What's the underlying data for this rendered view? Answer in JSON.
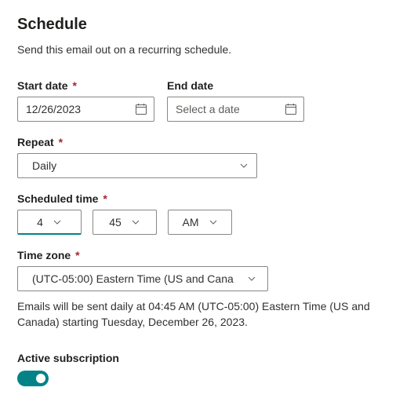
{
  "header": {
    "title": "Schedule",
    "description": "Send this email out on a recurring schedule."
  },
  "startDate": {
    "label": "Start date",
    "value": "12/26/2023",
    "required": true
  },
  "endDate": {
    "label": "End date",
    "placeholder": "Select a date",
    "required": false
  },
  "repeat": {
    "label": "Repeat",
    "value": "Daily",
    "required": true
  },
  "scheduledTime": {
    "label": "Scheduled time",
    "hour": "4",
    "minute": "45",
    "ampm": "AM",
    "required": true
  },
  "timezone": {
    "label": "Time zone",
    "value": "(UTC-05:00) Eastern Time (US and Cana",
    "required": true
  },
  "summary": "Emails will be sent daily at 04:45 AM (UTC-05:00) Eastern Time (US and Canada) starting Tuesday, December 26, 2023.",
  "activeSubscription": {
    "label": "Active subscription",
    "on": true
  },
  "requiredMarker": "*"
}
